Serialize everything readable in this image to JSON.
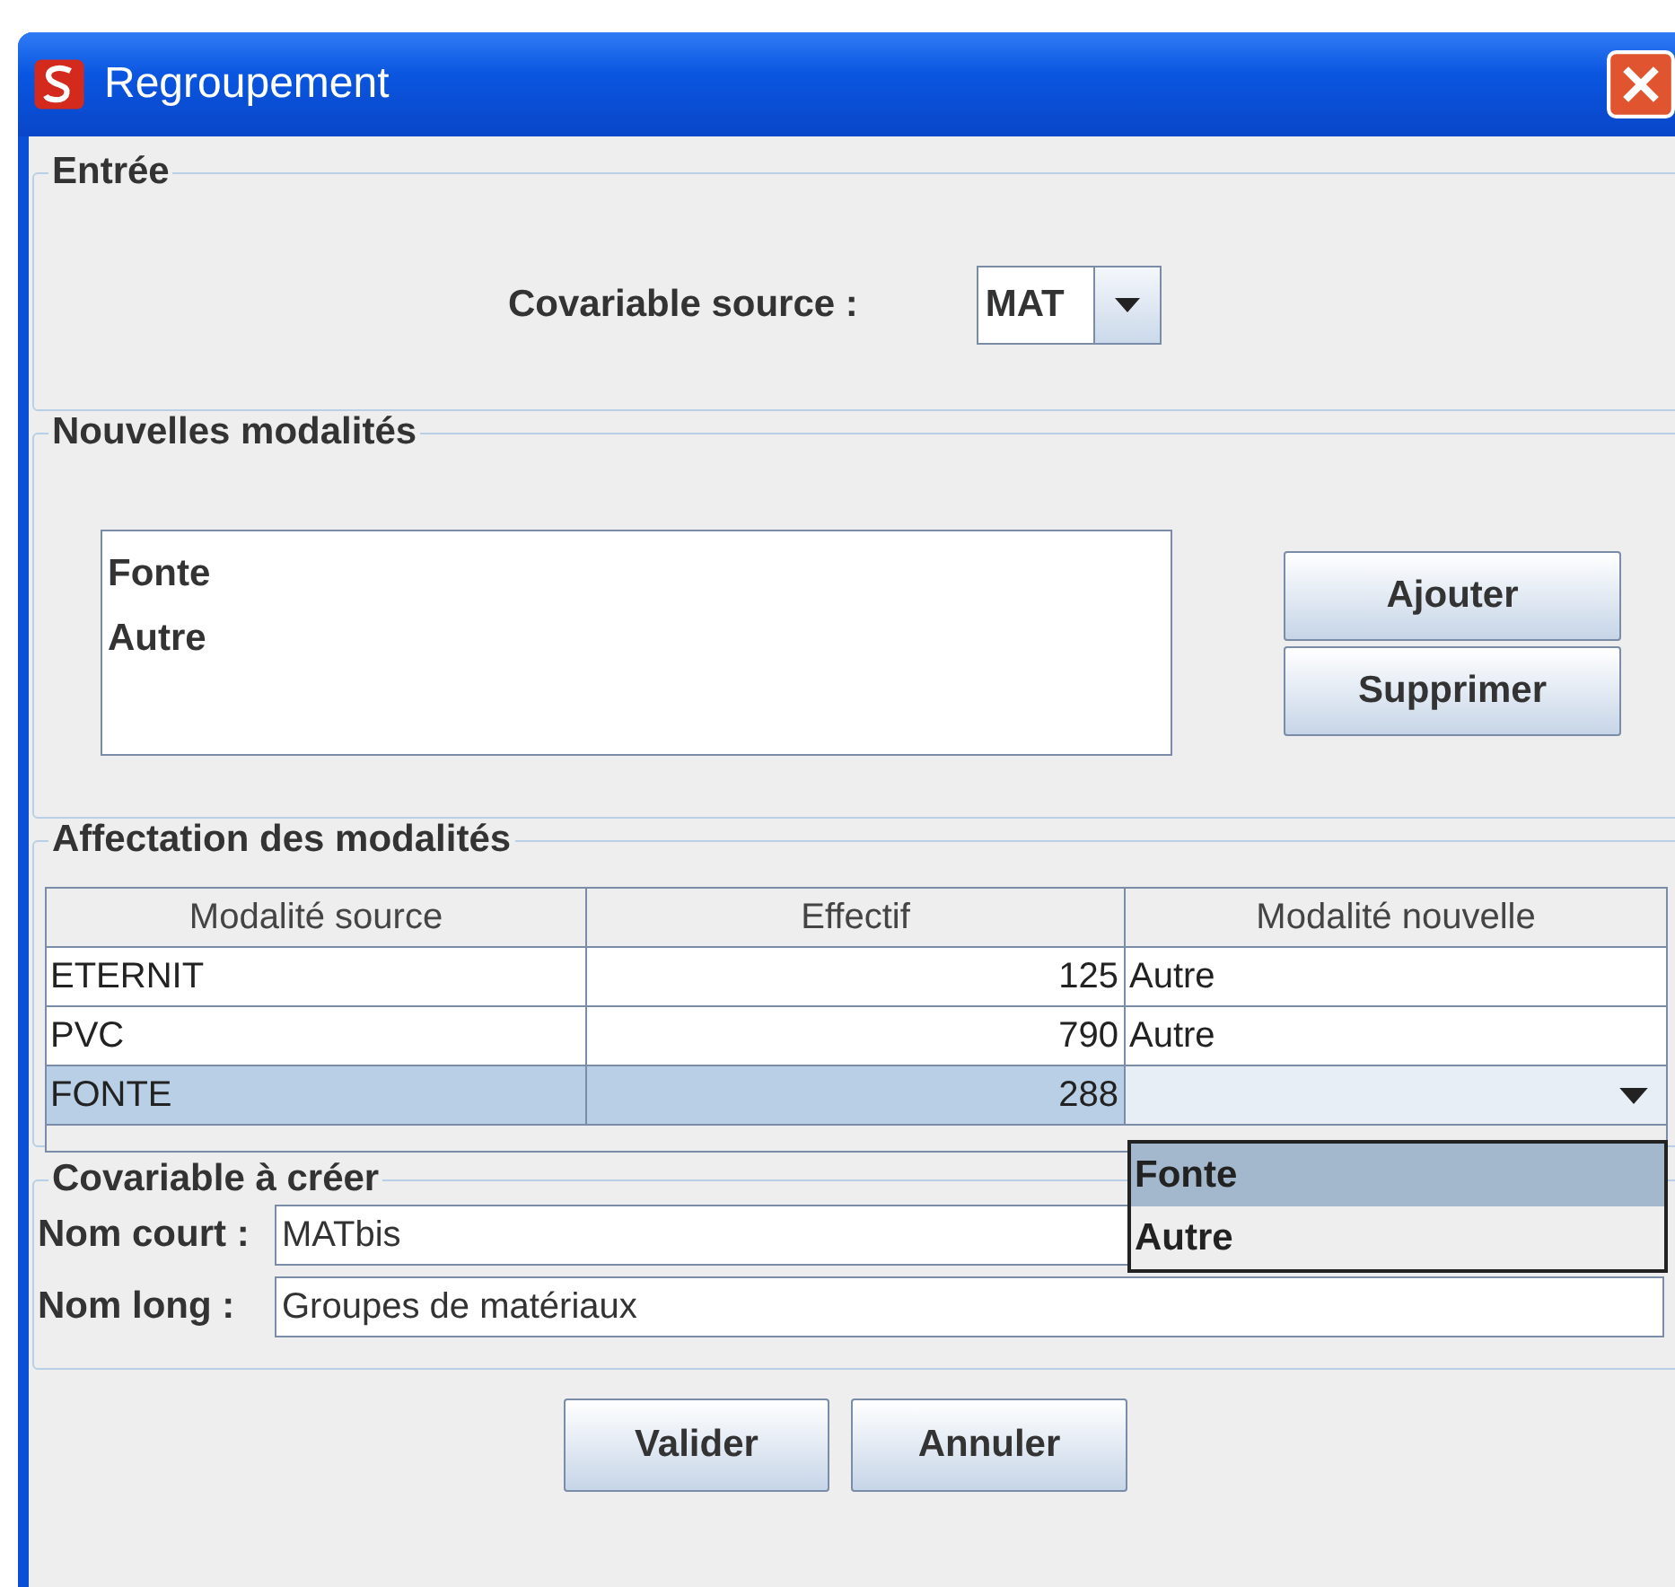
{
  "window": {
    "title": "Regroupement"
  },
  "entree": {
    "legend": "Entrée",
    "label": "Covariable source :",
    "value": "MAT"
  },
  "nouvelles": {
    "legend": "Nouvelles modalités",
    "items": [
      "Fonte",
      "Autre"
    ],
    "buttons": [
      "Ajouter",
      "Supprimer"
    ]
  },
  "affectation": {
    "legend": "Affectation des modalités",
    "columns": [
      "Modalité source",
      "Effectif",
      "Modalité nouvelle"
    ],
    "rows": [
      {
        "source": "ETERNIT",
        "effectif": "125",
        "nouvelle": "Autre",
        "selected": false,
        "editing": false
      },
      {
        "source": "PVC",
        "effectif": "790",
        "nouvelle": "Autre",
        "selected": false,
        "editing": false
      },
      {
        "source": "FONTE",
        "effectif": "288",
        "selected": true,
        "editing": true
      }
    ],
    "dropdown": [
      {
        "label": "Fonte",
        "selected": true
      },
      {
        "label": "Autre",
        "selected": false
      }
    ]
  },
  "creer": {
    "legend": "Covariable à créer",
    "fields": [
      {
        "label": "Nom court :",
        "value": "MATbis"
      },
      {
        "label": "Nom long :",
        "value": "Groupes de matériaux"
      }
    ]
  },
  "buttons": [
    "Valider",
    "Annuler"
  ]
}
